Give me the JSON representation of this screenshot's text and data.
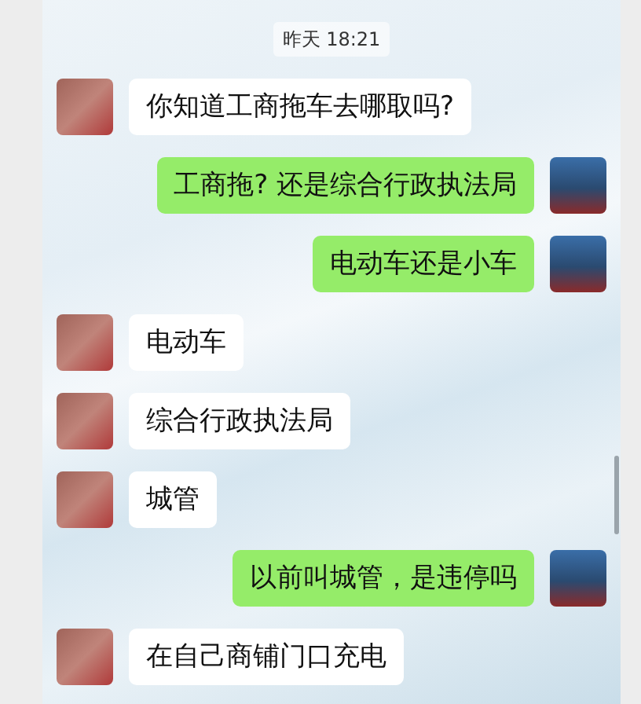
{
  "timestamp": "昨天 18:21",
  "messages": [
    {
      "kind": "received",
      "text": "你知道工商拖车去哪取吗?"
    },
    {
      "kind": "sent",
      "text": "工商拖? 还是综合行政执法局"
    },
    {
      "kind": "sent",
      "text": "电动车还是小车"
    },
    {
      "kind": "received",
      "text": "电动车"
    },
    {
      "kind": "received",
      "text": "综合行政执法局"
    },
    {
      "kind": "received",
      "text": "城管"
    },
    {
      "kind": "sent",
      "text": "以前叫城管，是违停吗"
    },
    {
      "kind": "received",
      "text": "在自己商铺门口充电"
    }
  ]
}
